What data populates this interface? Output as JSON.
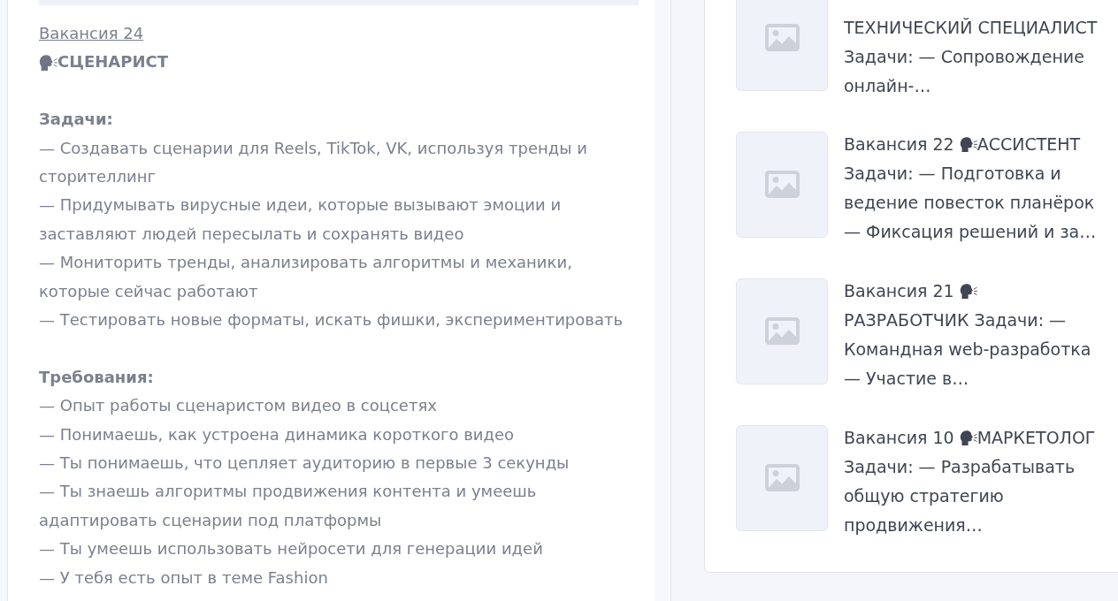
{
  "vacancy": {
    "link": "Вакансия 24",
    "title": "СЦЕНАРИСТ",
    "sections": [
      {
        "heading": "Задачи:",
        "items": [
          "— Создавать сценарии для Reels, TikTok, VK, используя тренды и сторителлинг",
          "— Придумывать вирусные идеи, которые вызывают эмоции и заставляют людей пересылать и сохранять видео",
          "— Мониторить тренды, анализировать алгоритмы и механики, которые сейчас работают",
          "— Тестировать новые форматы, искать фишки, экспериментировать"
        ]
      },
      {
        "heading": "Требования:",
        "items": [
          "— Опыт работы сценаристом видео в соцсетях",
          "— Понимаешь, как устроена динамика короткого видео",
          "— Ты понимаешь, что цепляет аудиторию в первые 3 секунды",
          "— Ты знаешь алгоритмы продвижения контента и умеешь адаптировать сценарии под платформы",
          "— Ты умеешь использовать нейросети для генерации идей",
          "— У тебя есть опыт в теме Fashion"
        ]
      }
    ]
  },
  "related": {
    "items": [
      {
        "text": "ТЕХНИЧЕСКИЙ СПЕЦИАЛИСТ Задачи: — Сопровождение онлайн-…"
      },
      {
        "label": "Вакансия 22",
        "text": "АССИСТЕНТ Задачи: — Подготовка и ведение повесток планёрок — Фиксация решений и за…"
      },
      {
        "label": "Вакансия 21",
        "text": "РАЗРАБОТЧИК Задачи: — Командная web-разработка — Участие в…"
      },
      {
        "label": "Вакансия 10",
        "text": "МАРКЕТОЛОГ Задачи: — Разрабатывать общую стратегию продвижения…"
      }
    ]
  }
}
